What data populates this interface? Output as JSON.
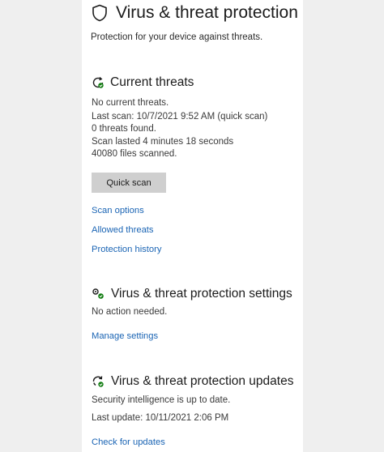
{
  "header": {
    "title": "Virus & threat protection",
    "subtitle": "Protection for your device against threats.",
    "icon": "shield-icon"
  },
  "current_threats": {
    "heading": "Current threats",
    "icon": "refresh-check-icon",
    "lines": [
      "No current threats.",
      "Last scan: 10/7/2021 9:52 AM (quick scan)",
      "0 threats found.",
      "Scan lasted 4 minutes 18 seconds",
      "40080 files scanned."
    ],
    "quick_scan_label": "Quick scan",
    "links": [
      "Scan options",
      "Allowed threats",
      "Protection history"
    ]
  },
  "settings": {
    "heading": "Virus & threat protection settings",
    "icon": "settings-gears-icon",
    "status": "No action needed.",
    "link": "Manage settings"
  },
  "updates": {
    "heading": "Virus & threat protection updates",
    "icon": "update-refresh-icon",
    "status": "Security intelligence is up to date.",
    "last_update": "Last update: 10/11/2021 2:06 PM",
    "link": "Check for updates"
  },
  "colors": {
    "link": "#1a64b4",
    "status_ok": "#107c10",
    "button_bg": "#cfcfcf"
  }
}
